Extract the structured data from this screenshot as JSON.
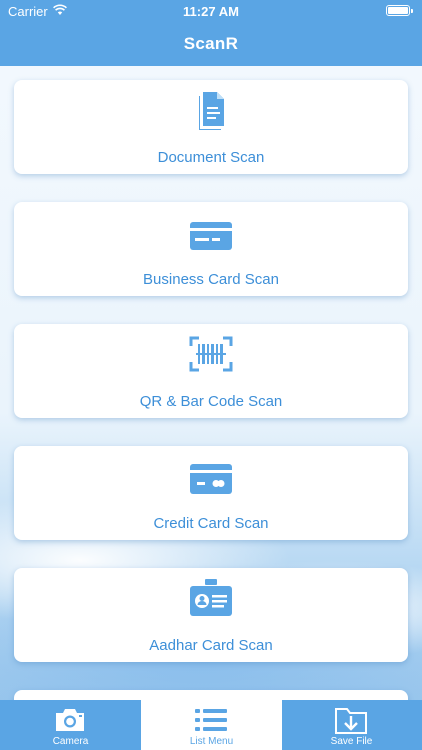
{
  "status_bar": {
    "carrier": "Carrier",
    "time": "11:27 AM"
  },
  "app": {
    "title": "ScanR",
    "accent": "#5aa5e4",
    "label_color": "#3d8fd8"
  },
  "menu": {
    "items": [
      {
        "label": "Document Scan",
        "icon": "document-icon"
      },
      {
        "label": "Business Card Scan",
        "icon": "business-card-icon"
      },
      {
        "label": "QR & Bar Code Scan",
        "icon": "barcode-icon"
      },
      {
        "label": "Credit Card Scan",
        "icon": "credit-card-icon"
      },
      {
        "label": "Aadhar Card Scan",
        "icon": "id-card-icon"
      }
    ]
  },
  "tabbar": {
    "tabs": [
      {
        "label": "Camera",
        "icon": "camera-icon"
      },
      {
        "label": "List Menu",
        "icon": "list-icon",
        "active": true
      },
      {
        "label": "Save File",
        "icon": "folder-download-icon"
      }
    ]
  }
}
